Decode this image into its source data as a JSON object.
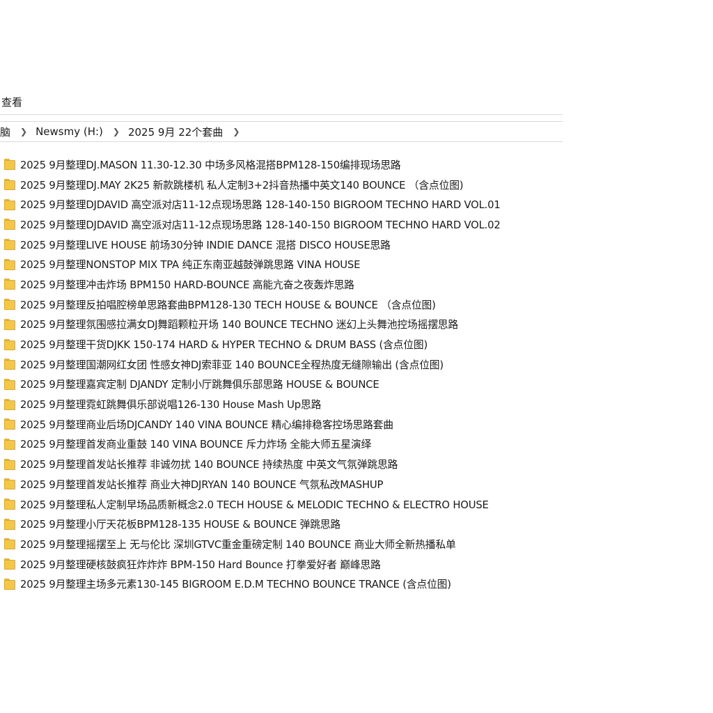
{
  "ribbon": {
    "view_tab": "查看"
  },
  "address": {
    "crumbs": [
      "脑",
      "Newsmy (H:)",
      "2025 9月 22个套曲"
    ]
  },
  "icons": {
    "folder": "folder-icon",
    "folder_color": "#f5c746"
  },
  "files": [
    "2025 9月整理DJ.MASON 11.30-12.30 中场多风格混搭BPM128-150编排现场思路",
    "2025 9月整理DJ.MAY 2K25 新款跳楼机 私人定制3+2抖音热播中英文140 BOUNCE （含点位图)",
    "2025 9月整理DJDAVID 高空派对店11-12点现场思路 128-140-150 BIGROOM TECHNO HARD VOL.01",
    "2025 9月整理DJDAVID 高空派对店11-12点现场思路 128-140-150 BIGROOM TECHNO HARD VOL.02",
    "2025 9月整理LIVE HOUSE 前场30分钟 INDIE DANCE 混搭 DISCO HOUSE思路",
    "2025 9月整理NONSTOP MIX TPA 纯正东南亚越鼓弹跳思路 VINA HOUSE",
    "2025 9月整理冲击炸场 BPM150 HARD-BOUNCE 高能亢奋之夜轰炸思路",
    "2025 9月整理反拍唱腔榜单思路套曲BPM128-130 TECH HOUSE & BOUNCE （含点位图)",
    "2025 9月整理氛围感拉满女DJ舞蹈颗粒开场 140 BOUNCE TECHNO 迷幻上头舞池控场摇摆思路",
    "2025 9月整理干货DJKK 150-174 HARD & HYPER TECHNO & DRUM BASS (含点位图)",
    "2025 9月整理国潮网红女团 性感女神DJ索菲亚 140 BOUNCE全程热度无缝隙输出 (含点位图)",
    "2025 9月整理嘉宾定制 DJANDY 定制小厅跳舞俱乐部思路 HOUSE & BOUNCE",
    "2025 9月整理霓虹跳舞俱乐部说唱126-130 House Mash Up思路",
    "2025 9月整理商业后场DJCANDY 140 VINA BOUNCE 精心编排稳客控场思路套曲",
    "2025 9月整理首发商业重鼓 140 VINA BOUNCE 斥力炸场 全能大师五星演绎",
    "2025 9月整理首发站长推荐 非诚勿扰 140 BOUNCE 持续热度 中英文气氛弹跳思路",
    "2025 9月整理首发站长推荐 商业大神DJRYAN 140 BOUNCE 气氛私改MASHUP",
    "2025 9月整理私人定制早场品质新概念2.0 TECH HOUSE & MELODIC TECHNO & ELECTRO HOUSE",
    "2025 9月整理小厅天花板BPM128-135 HOUSE & BOUNCE 弹跳思路",
    "2025 9月整理摇摆至上 无与伦比 深圳GTVC重金重磅定制 140 BOUNCE 商业大师全新热播私单",
    "2025 9月整理硬核鼓疯狂炸炸炸 BPM-150 Hard Bounce 打拳爱好者 巅峰思路",
    "2025 9月整理主场多元素130-145 BIGROOM E.D.M TECHNO BOUNCE TRANCE (含点位图)"
  ]
}
